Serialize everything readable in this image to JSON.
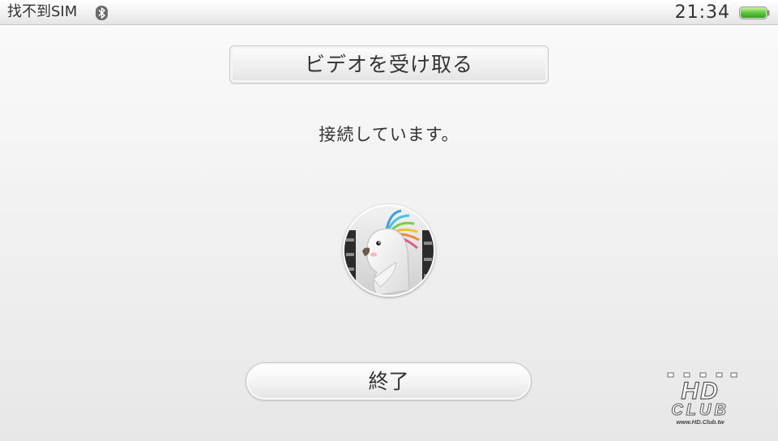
{
  "status_bar": {
    "carrier": "找不到SIM",
    "bluetooth_icon": "bluetooth-icon",
    "time": "21:34",
    "battery_icon": "battery-icon",
    "battery_level": 1.0,
    "battery_color": "#5cc53a"
  },
  "main": {
    "title_button_label": "ビデオを受け取る",
    "status_message": "接続しています。",
    "avatar_icon": "bird-avatar",
    "end_button_label": "終了"
  },
  "watermark": {
    "brand_top": "HD",
    "brand_bottom": "CLUB",
    "url": "www.HD.Club.tw"
  }
}
